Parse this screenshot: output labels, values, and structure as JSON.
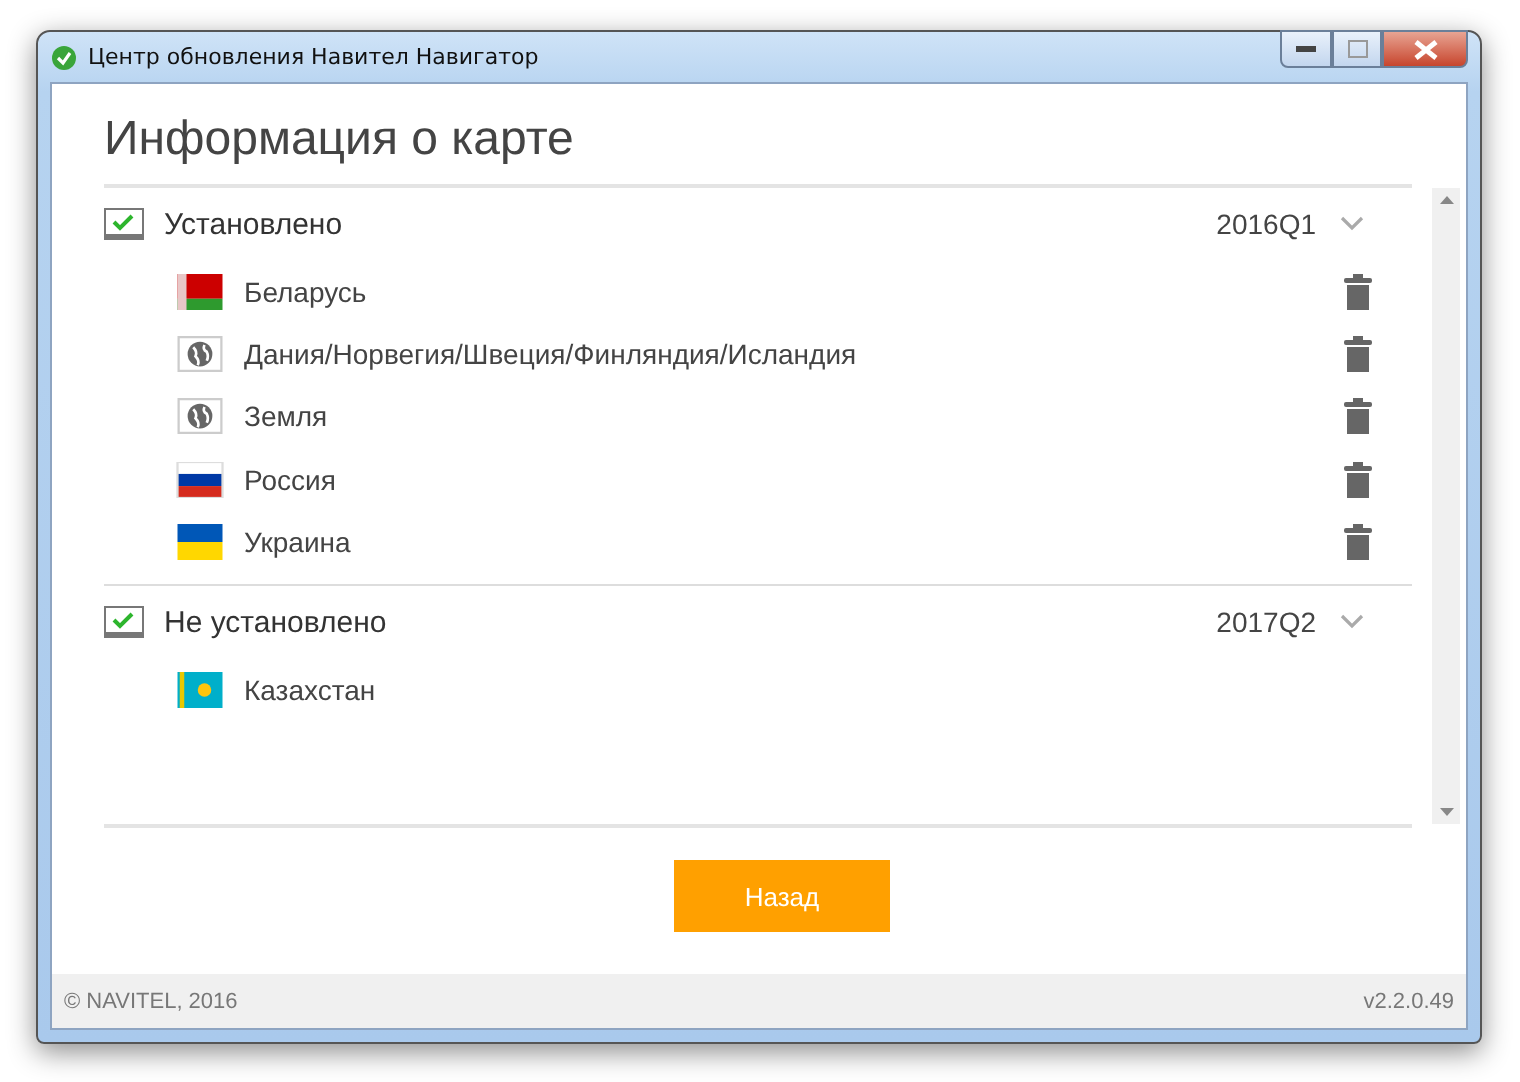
{
  "window": {
    "title": "Центр обновления Навител Навигатор"
  },
  "heading": "Информация о карте",
  "sections": [
    {
      "title": "Установлено",
      "version": "2016Q1",
      "items": [
        {
          "name": "Беларусь",
          "kind": "belarus",
          "deletable": true
        },
        {
          "name": "Дания/Норвегия/Швеция/Финляндия/Исландия",
          "kind": "globe",
          "deletable": true
        },
        {
          "name": "Земля",
          "kind": "globe",
          "deletable": true
        },
        {
          "name": "Россия",
          "kind": "russia",
          "deletable": true
        },
        {
          "name": "Украина",
          "kind": "ukraine",
          "deletable": true
        }
      ]
    },
    {
      "title": "Не установлено",
      "version": "2017Q2",
      "items": [
        {
          "name": "Казахстан",
          "kind": "kazakhstan",
          "deletable": false
        }
      ]
    }
  ],
  "back_button": "Назад",
  "footer": {
    "copyright": "© NAVITEL, 2016",
    "version": "v2.2.0.49"
  }
}
